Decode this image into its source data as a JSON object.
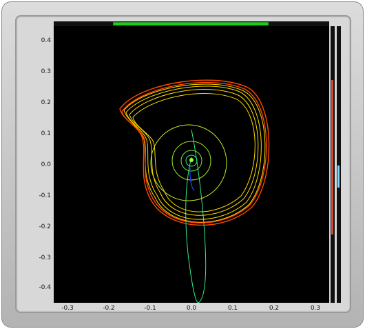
{
  "plot": {
    "background": "#000000",
    "x_ticks": [
      "-0.3",
      "-0.2",
      "-0.1",
      "0.0",
      "0.1",
      "0.2",
      "0.3"
    ],
    "y_ticks": [
      "0.4",
      "0.3",
      "0.2",
      "0.1",
      "0.0",
      "-0.1",
      "-0.2",
      "-0.3",
      "-0.4"
    ]
  },
  "colors": {
    "orbit_outer": "#ff4a00",
    "orbit_mid": "#ffdd00",
    "orbit_inner": "#aaee22",
    "trajectory": "#33ee88",
    "tail": "#2244ff",
    "scroll_thumb": "#1ad11a",
    "level_red": "#d64a3a",
    "level_blue": "#7fd6ff"
  },
  "controls": {
    "horizontal_scroll_position": 0.4,
    "red_level": 0.56,
    "blue_level": 0.08
  }
}
